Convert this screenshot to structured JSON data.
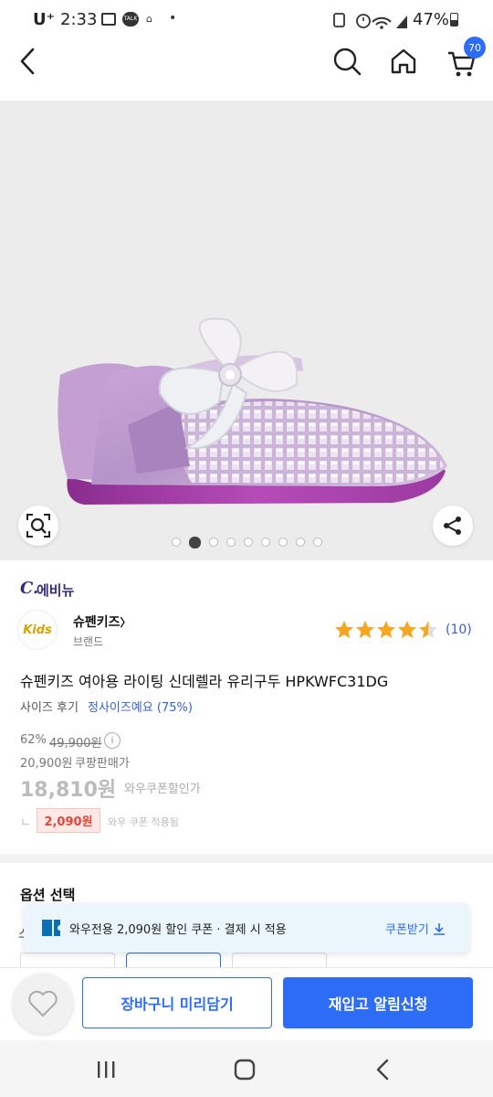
{
  "status": {
    "carrier": "U⁺",
    "time": "2:33",
    "battery": "47%"
  },
  "header": {
    "cart_count": "70"
  },
  "gallery": {
    "image_count": 9,
    "active_index": 1
  },
  "seller": {
    "logo_text": "C.",
    "name": "에비뉴"
  },
  "brand": {
    "logo_text": "Kids",
    "name": "슈펜키즈",
    "chevron": "〉",
    "sub": "브랜드",
    "rating": 4.5,
    "review_count": "(10)"
  },
  "product": {
    "title": "슈펜키즈 여아용 라이팅 신데렐라 유리구두 HPKWFC31DG",
    "size_review_label": "사이즈 후기",
    "size_review_value": "정사이즈예요 (75%)",
    "discount_rate": "62%",
    "original_price": "49,900원",
    "info_icon": "i",
    "coupang_price": "20,900원",
    "coupang_price_label": "쿠팡판매가",
    "wow_price": "18,810원",
    "wow_price_label": "와우쿠폰할인가",
    "coupon_prefix": "ㄴ",
    "coupon_amount": "2,090원",
    "coupon_applied": "와우 쿠폰 적용됨"
  },
  "options": {
    "title": "옵션 선택",
    "partial_label": "스"
  },
  "toast": {
    "text": "와우전용 2,090원 할인 쿠폰 · 결제 시 적용",
    "action": "쿠폰받기"
  },
  "actions": {
    "cart": "장바구니 미리담기",
    "restock": "재입고 알림신청"
  },
  "colors": {
    "accent": "#2d6cf5",
    "price_red": "#e0473b",
    "star": "#f5a623"
  }
}
